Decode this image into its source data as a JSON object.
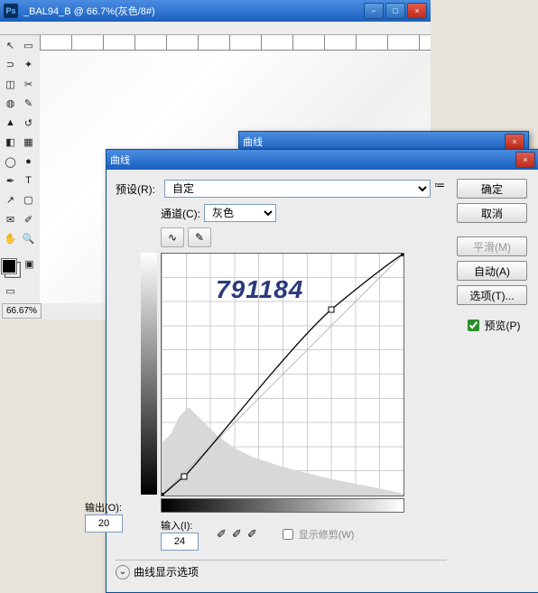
{
  "main_window": {
    "app_icon": "Ps",
    "title": "_BAL94_B @ 66.7%(灰色/8#)",
    "zoom": "66.67%"
  },
  "small_dialog_title": "曲线",
  "dialog": {
    "title": "曲线",
    "preset_label": "预设(R):",
    "preset_value": "自定",
    "channel_label": "通道(C):",
    "channel_value": "灰色",
    "output_label": "输出(O):",
    "output_value": "20",
    "input_label": "输入(I):",
    "input_value": "24",
    "show_clipping": "显示修剪(W)",
    "expand": "曲线显示选项",
    "buttons": {
      "ok": "确定",
      "cancel": "取消",
      "smooth": "平滑(M)",
      "auto": "自动(A)",
      "options": "选项(T)...",
      "preview": "预览(P)"
    }
  },
  "watermark": "791184",
  "chart_data": {
    "type": "line",
    "title": "曲线",
    "xlabel": "输入",
    "ylabel": "输出",
    "xlim": [
      0,
      255
    ],
    "ylim": [
      0,
      255
    ],
    "control_points": [
      {
        "x": 0,
        "y": 0
      },
      {
        "x": 24,
        "y": 20
      },
      {
        "x": 179,
        "y": 184
      },
      {
        "x": 255,
        "y": 255
      }
    ],
    "baseline": [
      {
        "x": 0,
        "y": 0
      },
      {
        "x": 255,
        "y": 255
      }
    ]
  }
}
